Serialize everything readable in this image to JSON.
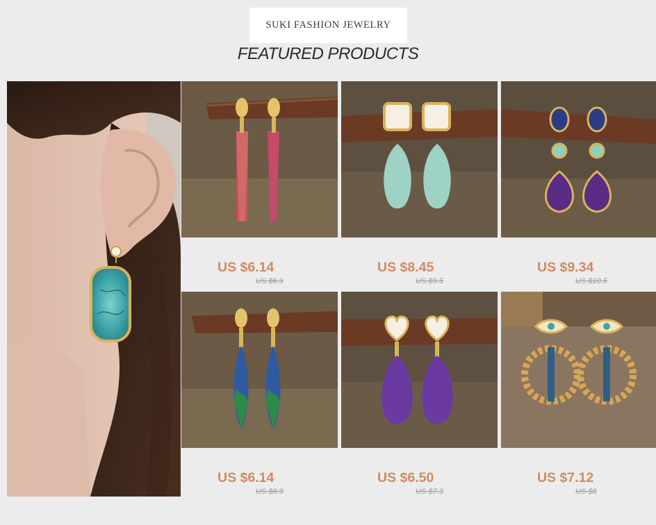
{
  "store": {
    "logo_text": "SUKI FASHION JEWELRY",
    "section_title": "FEATURED PRODUCTS"
  },
  "colors": {
    "background": "#ececec",
    "price": "#cf8c63",
    "old_price": "#9a9a9a",
    "title": "#2b2b2b"
  },
  "products": [
    {
      "price": "US $6.14",
      "old_price": "US $6.9",
      "image": "red-jasper-drop-earrings"
    },
    {
      "price": "US $8.45",
      "old_price": "US $9.5",
      "image": "fluorite-teardrop-earrings"
    },
    {
      "price": "US $9.34",
      "old_price": "US $10.5",
      "image": "lapis-amethyst-earrings"
    },
    {
      "price": "US $6.14",
      "old_price": "US $6.9",
      "image": "blue-green-jasper-earrings"
    },
    {
      "price": "US $6.50",
      "old_price": "US $7.3",
      "image": "amethyst-heart-earrings"
    },
    {
      "price": "US $7.12",
      "old_price": "US $8",
      "image": "evil-eye-sun-earrings"
    }
  ]
}
